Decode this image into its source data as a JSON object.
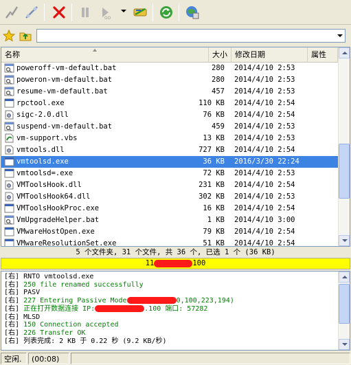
{
  "toolbar": {
    "icons": [
      "connect-icon",
      "disconnect-icon",
      "stop-icon",
      "pause-icon",
      "skip-icon",
      "transfer-icon",
      "refresh-icon",
      "site-icon"
    ]
  },
  "address": {
    "value": ""
  },
  "columns": {
    "name": "名称",
    "size": "大小",
    "date": "修改日期",
    "attr": "属性"
  },
  "files": [
    {
      "name": "poweroff-vm-default.bat",
      "size": "280",
      "date": "2014/4/10 2:53",
      "icon": "bat"
    },
    {
      "name": "poweron-vm-default.bat",
      "size": "280",
      "date": "2014/4/10 2:53",
      "icon": "bat"
    },
    {
      "name": "resume-vm-default.bat",
      "size": "457",
      "date": "2014/4/10 2:53",
      "icon": "bat"
    },
    {
      "name": "rpctool.exe",
      "size": "110 KB",
      "date": "2014/4/10 2:54",
      "icon": "exe"
    },
    {
      "name": "sigc-2.0.dll",
      "size": "76 KB",
      "date": "2014/4/10 2:54",
      "icon": "dll"
    },
    {
      "name": "suspend-vm-default.bat",
      "size": "459",
      "date": "2014/4/10 2:53",
      "icon": "bat"
    },
    {
      "name": "vm-support.vbs",
      "size": "13 KB",
      "date": "2014/4/10 2:53",
      "icon": "vbs"
    },
    {
      "name": "vmtools.dll",
      "size": "727 KB",
      "date": "2014/4/10 2:54",
      "icon": "dll"
    },
    {
      "name": "vmtoolsd.exe",
      "size": "36 KB",
      "date": "2016/3/30 22:24",
      "icon": "exe",
      "selected": true
    },
    {
      "name": "vmtoolsd=.exe",
      "size": "72 KB",
      "date": "2014/4/10 2:53",
      "icon": "exe"
    },
    {
      "name": "VMToolsHook.dll",
      "size": "231 KB",
      "date": "2014/4/10 2:54",
      "icon": "dll"
    },
    {
      "name": "VMToolsHook64.dll",
      "size": "302 KB",
      "date": "2014/4/10 2:53",
      "icon": "dll"
    },
    {
      "name": "VMToolsHookProc.exe",
      "size": "16 KB",
      "date": "2014/4/10 2:54",
      "icon": "exe"
    },
    {
      "name": "VmUpgradeHelper.bat",
      "size": "1 KB",
      "date": "2014/4/10 3:00",
      "icon": "bat"
    },
    {
      "name": "VMwareHostOpen.exe",
      "size": "79 KB",
      "date": "2014/4/10 2:54",
      "icon": "exe"
    },
    {
      "name": "VMwareResolutionSet.exe",
      "size": "51 KB",
      "date": "2014/4/10 2:54",
      "icon": "exe"
    }
  ],
  "summary": "5 个文件夹, 31 个文件, 共 36 个, 已选 1 个 (36 KB)",
  "status_bar": {
    "left": "11",
    "right": "100"
  },
  "log": [
    {
      "tag": "[右]",
      "text": " RNTO vmtoolsd.exe",
      "color": "dark"
    },
    {
      "tag": "[右]",
      "text": " 250 file renamed successfully",
      "color": "green"
    },
    {
      "tag": "[右]",
      "text": " PASV",
      "color": "dark"
    },
    {
      "tag": "[右]",
      "text": " 227 Entering Passive Mode",
      "tail": "0,100,223,194)",
      "color": "green",
      "redact": true
    },
    {
      "tag": "[右]",
      "text": " 正在打开数据连接 IP:",
      "tail": ".100 端口: 57282",
      "color": "green",
      "redact": true
    },
    {
      "tag": "[右]",
      "text": " MLSD",
      "color": "dark"
    },
    {
      "tag": "[右]",
      "text": " 150 Connection accepted",
      "color": "green"
    },
    {
      "tag": "[右]",
      "text": " 226 Transfer OK",
      "color": "green"
    },
    {
      "tag": "[右]",
      "text": " 列表完成: 2 KB 于 0.22 秒 (9.2 KB/秒)",
      "color": "dark"
    }
  ],
  "bottom": {
    "state": "空闲.",
    "time": "(00:08)"
  },
  "colors": {
    "selected": "#3d83e4",
    "status_yellow": "#ffff00",
    "log_green": "#008000",
    "redact": "#ff1a1a"
  }
}
